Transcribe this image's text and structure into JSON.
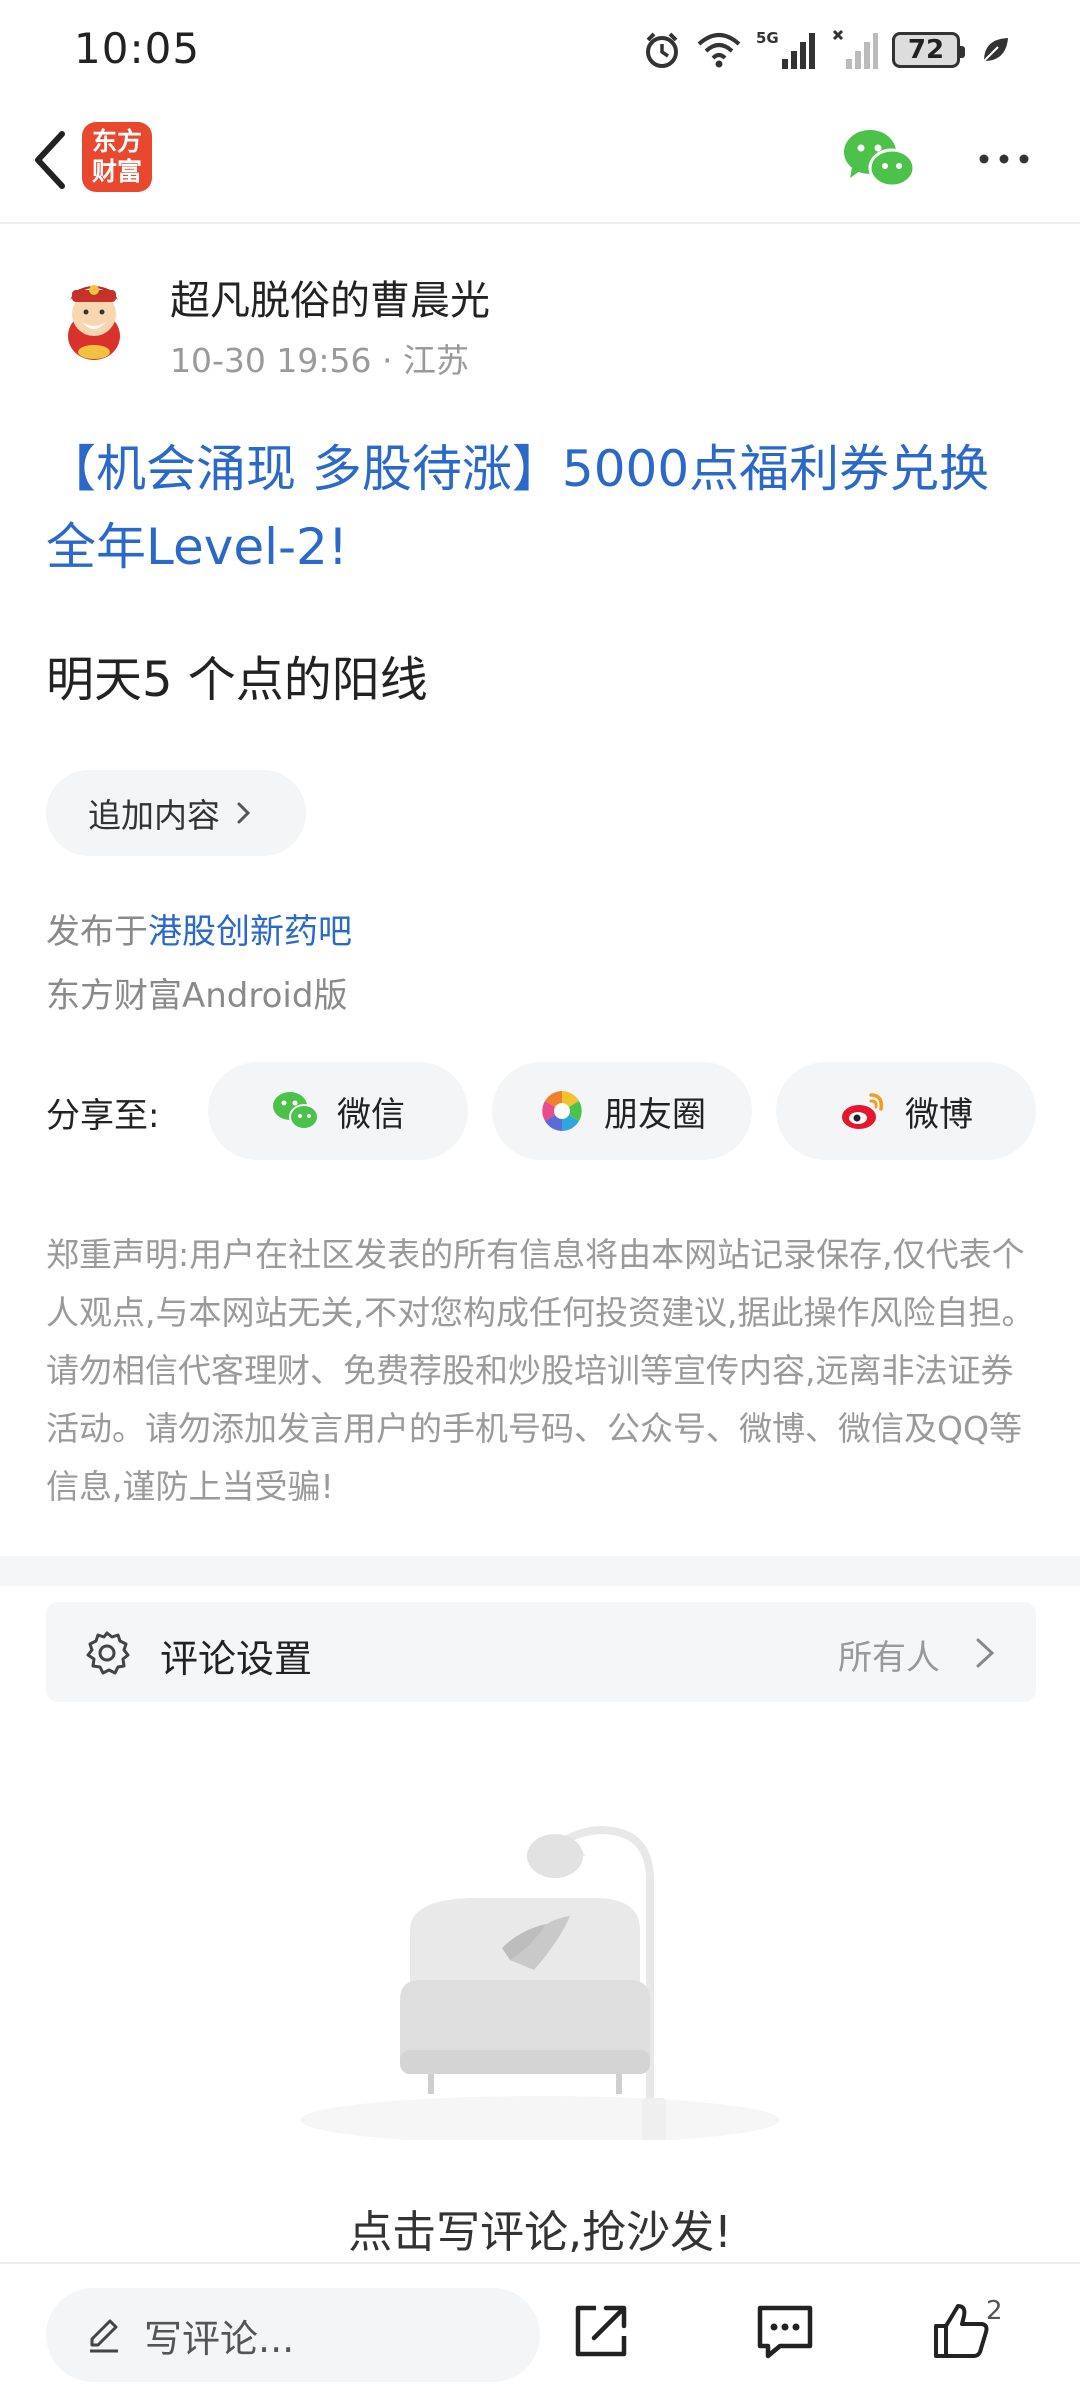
{
  "status_bar": {
    "time": "10:05",
    "battery": "72",
    "network": "5G"
  },
  "nav": {
    "logo_text_line1": "东方",
    "logo_text_line2": "财富"
  },
  "post": {
    "author": "超凡脱俗的曹晨光",
    "meta": "10-30 19:56 · 江苏",
    "title": "【机会涌现 多股待涨】5000点福利券兑换全年Level-2!",
    "body": "明天5 个点的阳线",
    "add_content_label": "追加内容",
    "posted_prefix": "发布于",
    "posted_bar": "港股创新药吧",
    "client": "东方财富Android版"
  },
  "share": {
    "label": "分享至:",
    "buttons": [
      {
        "label": "微信",
        "icon": "wechat-icon"
      },
      {
        "label": "朋友圈",
        "icon": "moments-icon"
      },
      {
        "label": "微博",
        "icon": "weibo-icon"
      }
    ]
  },
  "disclaimer": "郑重声明:用户在社区发表的所有信息将由本网站记录保存,仅代表个人观点,与本网站无关,不对您构成任何投资建议,据此操作风险自担。请勿相信代客理财、免费荐股和炒股培训等宣传内容,远离非法证券活动。请勿添加发言用户的手机号码、公众号、微博、微信及QQ等信息,谨防上当受骗!",
  "comment_settings": {
    "title": "评论设置",
    "value": "所有人"
  },
  "empty_state": {
    "text": "点击写评论,抢沙发!"
  },
  "bottom_bar": {
    "input_placeholder": "写评论...",
    "like_count": "2"
  },
  "colors": {
    "link_blue": "#2b69c8",
    "brand_red": "#e8482d",
    "wechat_green": "#4cc24a"
  }
}
